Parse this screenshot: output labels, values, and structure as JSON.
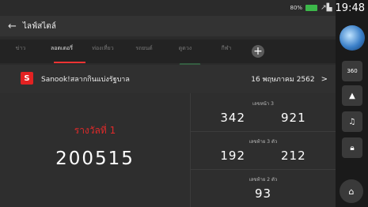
{
  "status": {
    "battery": "80%",
    "signal": "↗▙",
    "time": "19:48"
  },
  "header": {
    "title": "ไลฟ์สไตล์"
  },
  "tabs": [
    {
      "label": "ข่าว"
    },
    {
      "label": "ลอตเตอรี่"
    },
    {
      "label": "ท่องเที่ยว"
    },
    {
      "label": "รถยนต์"
    },
    {
      "label": "ดูดวง"
    },
    {
      "label": "กีฬา"
    }
  ],
  "source": {
    "logo_letter": "S",
    "name": "Sanook!สลากกินแบ่งรัฐบาล",
    "date": "16 พฤษภาคม 2562"
  },
  "first_prize": {
    "label": "รางวัลที่ 1",
    "number": "200515"
  },
  "front3": {
    "label": "เลขหน้า 3",
    "values": [
      "342",
      "921"
    ]
  },
  "last3": {
    "label": "เลขท้าย 3 ตัว",
    "values": [
      "192",
      "212"
    ]
  },
  "last2": {
    "label": "เลขท้าย 2 ตัว",
    "value": "93"
  },
  "sidebar": {
    "rotate_label": "360"
  },
  "colors": {
    "accent": "#e02a2a",
    "background": "#2b2b2b"
  }
}
